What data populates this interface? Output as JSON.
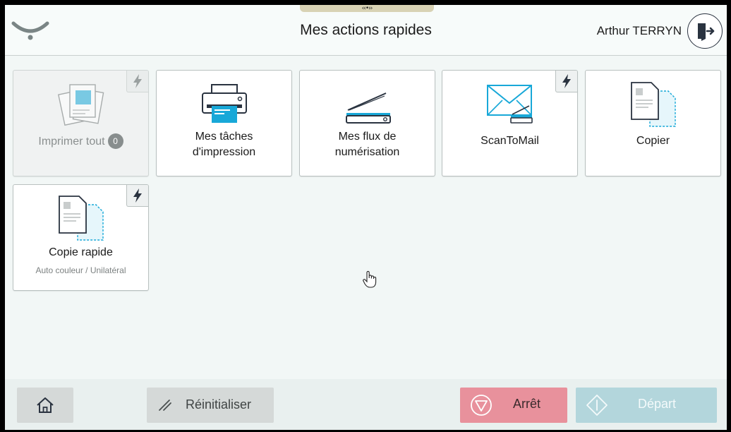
{
  "header": {
    "title": "Mes actions rapides",
    "user_name": "Arthur TERRYN"
  },
  "tiles": [
    {
      "label": "Imprimer tout",
      "badge": "0",
      "disabled": true,
      "flash": true,
      "icon": "print-all-icon"
    },
    {
      "label_line1": "Mes tâches",
      "label_line2": "d'impression",
      "icon": "printer-icon"
    },
    {
      "label_line1": "Mes flux de",
      "label_line2": "numérisation",
      "icon": "scanner-icon"
    },
    {
      "label": "ScanToMail",
      "flash": true,
      "icon": "scan-to-mail-icon"
    },
    {
      "label": "Copier",
      "icon": "copy-icon"
    },
    {
      "label": "Copie rapide",
      "sublabel": "Auto couleur / Unilatéral",
      "flash": true,
      "icon": "quick-copy-icon"
    }
  ],
  "footer": {
    "reset_label": "Réinitialiser",
    "stop_label": "Arrêt",
    "start_label": "Départ"
  },
  "colors": {
    "accent": "#18a8d8",
    "stop": "#e8919c",
    "start_disabled": "#b3d6dc",
    "background": "#f2f7f6"
  }
}
